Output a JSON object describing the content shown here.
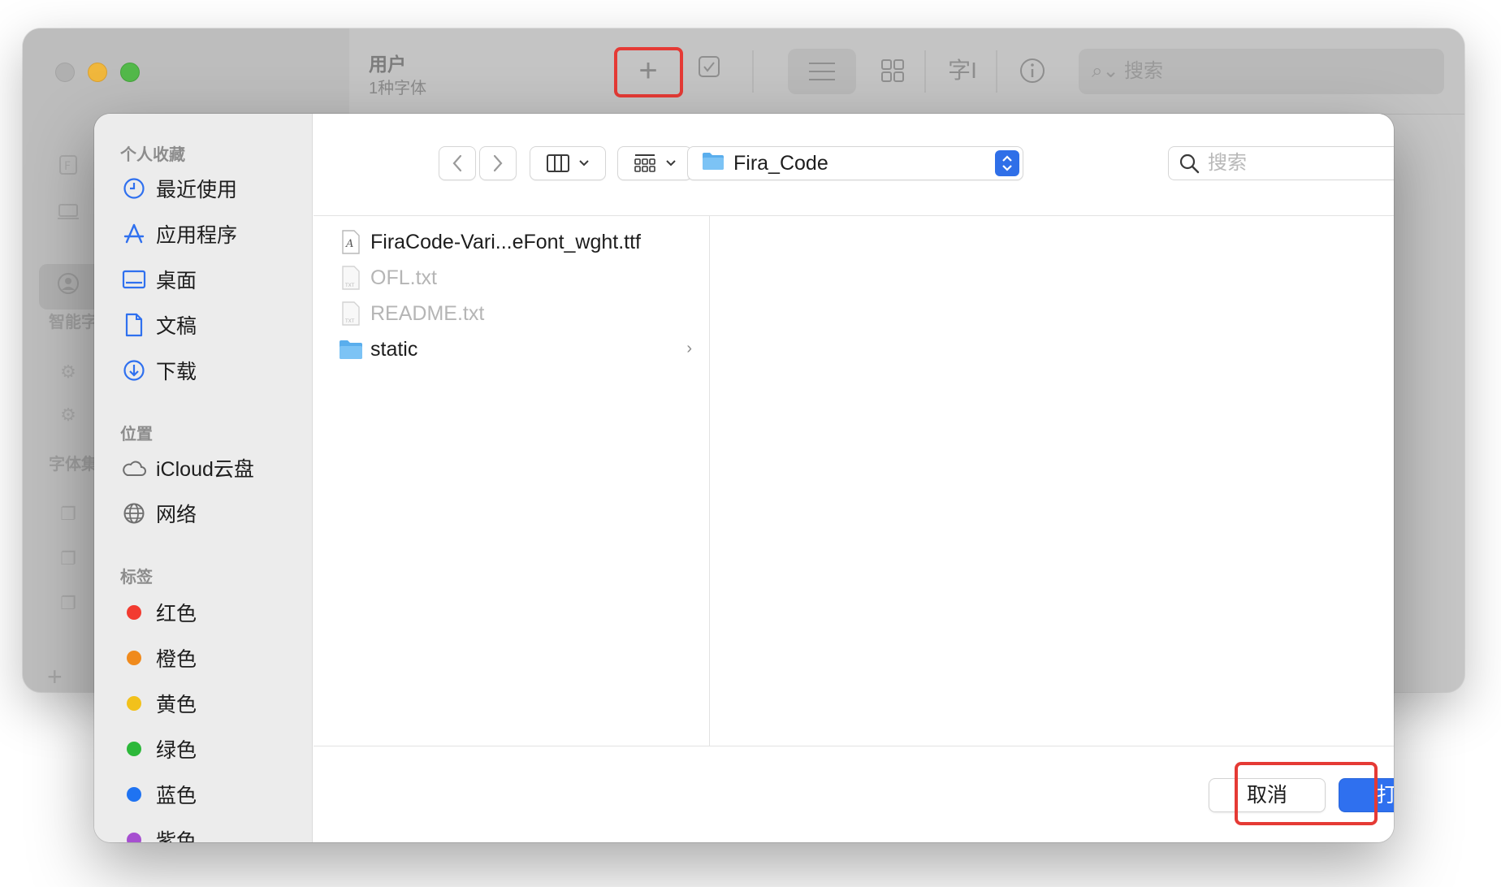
{
  "background_window": {
    "title": "用户",
    "subtitle": "1种字体",
    "search_placeholder": "搜索",
    "sidebar_labels": [
      "智能字",
      "字体集"
    ]
  },
  "dialog": {
    "sidebar": {
      "sections": [
        {
          "label": "个人收藏"
        },
        {
          "label": "位置"
        },
        {
          "label": "标签"
        }
      ],
      "favorites": [
        {
          "label": "最近使用",
          "icon": "clock-icon"
        },
        {
          "label": "应用程序",
          "icon": "app-store-icon"
        },
        {
          "label": "桌面",
          "icon": "desktop-icon"
        },
        {
          "label": "文稿",
          "icon": "document-icon"
        },
        {
          "label": "下载",
          "icon": "download-icon"
        }
      ],
      "locations": [
        {
          "label": "iCloud云盘",
          "icon": "cloud-icon"
        },
        {
          "label": "网络",
          "icon": "globe-icon"
        }
      ],
      "tags": [
        {
          "label": "红色",
          "color": "#f23b30"
        },
        {
          "label": "橙色",
          "color": "#f08a1c"
        },
        {
          "label": "黄色",
          "color": "#f2c11b"
        },
        {
          "label": "绿色",
          "color": "#2cb83a"
        },
        {
          "label": "蓝色",
          "color": "#1f73f2"
        },
        {
          "label": "紫色",
          "color": "#a64fd0"
        }
      ]
    },
    "toolbar": {
      "current_folder": "Fira_Code",
      "search_placeholder": "搜索"
    },
    "files": [
      {
        "name": "FiraCode-Vari...eFont_wght.ttf",
        "kind": "font",
        "enabled": true
      },
      {
        "name": "OFL.txt",
        "kind": "txt",
        "enabled": false
      },
      {
        "name": "README.txt",
        "kind": "txt",
        "enabled": false
      },
      {
        "name": "static",
        "kind": "folder",
        "enabled": true
      }
    ],
    "buttons": {
      "cancel": "取消",
      "open": "打开"
    }
  },
  "colors": {
    "accent": "#2f70ef",
    "highlight": "#e53a35"
  }
}
